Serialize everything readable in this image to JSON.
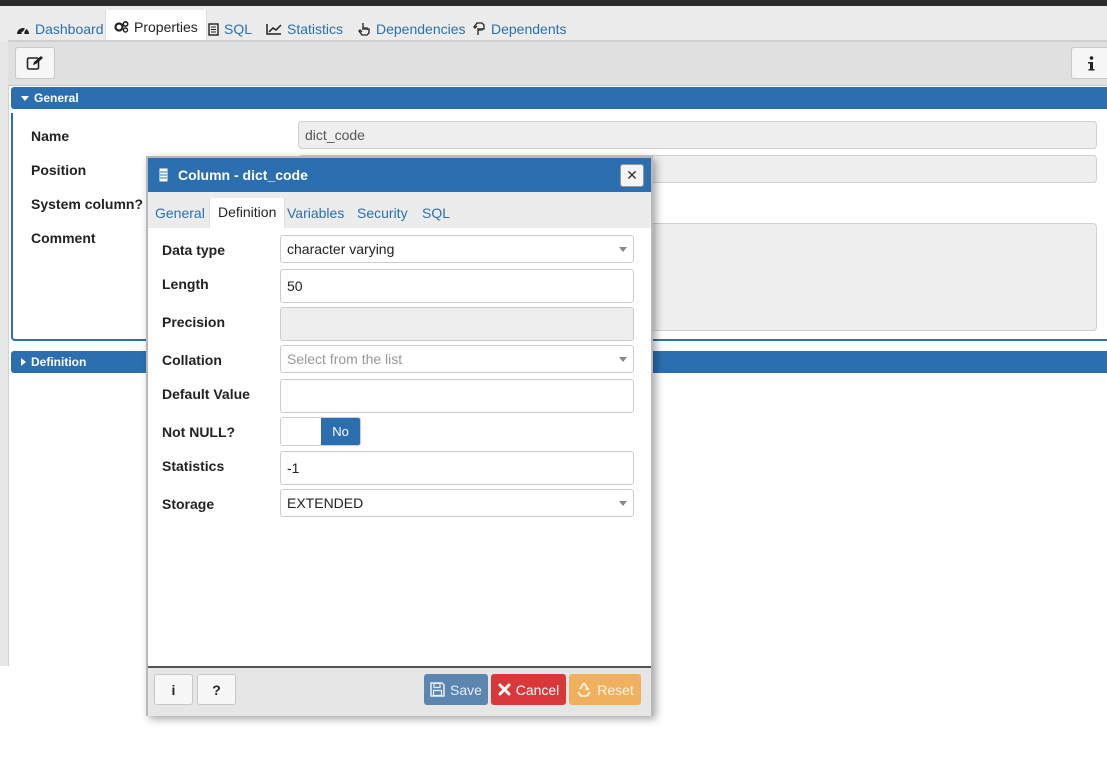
{
  "tabs": [
    {
      "label": "Dashboard",
      "icon": "dashboard-icon"
    },
    {
      "label": "Properties",
      "icon": "cogs-icon"
    },
    {
      "label": "SQL",
      "icon": "document-icon"
    },
    {
      "label": "Statistics",
      "icon": "line-chart-icon"
    },
    {
      "label": "Dependencies",
      "icon": "hand-pointer-icon"
    },
    {
      "label": "Dependents",
      "icon": "hand-pointer-icon"
    }
  ],
  "active_tab": "Properties",
  "toolbar": {
    "edit_icon": "edit-icon",
    "info_icon": "info-icon"
  },
  "general_section": {
    "title": "General",
    "fields": {
      "name_label": "Name",
      "name_value": "dict_code",
      "position_label": "Position",
      "system_column_label": "System column?",
      "comment_label": "Comment"
    }
  },
  "definition_section": {
    "title": "Definition"
  },
  "dialog": {
    "title": "Column - dict_code",
    "title_icon": "column-icon",
    "tabs": [
      "General",
      "Definition",
      "Variables",
      "Security",
      "SQL"
    ],
    "active_tab": "Definition",
    "fields": {
      "data_type_label": "Data type",
      "data_type_value": "character varying",
      "length_label": "Length",
      "length_value": "50",
      "precision_label": "Precision",
      "collation_label": "Collation",
      "collation_placeholder": "Select from the list",
      "default_value_label": "Default Value",
      "not_null_label": "Not NULL?",
      "not_null_value": "No",
      "statistics_label": "Statistics",
      "statistics_value": "-1",
      "storage_label": "Storage",
      "storage_value": "EXTENDED"
    },
    "footer": {
      "info_label": "i",
      "help_label": "?",
      "save_label": "Save",
      "cancel_label": "Cancel",
      "reset_label": "Reset"
    }
  },
  "colors": {
    "accent": "#2c6fb0",
    "cancel": "#d9383a",
    "reset": "#f0b15f",
    "save": "#5c85b0"
  }
}
